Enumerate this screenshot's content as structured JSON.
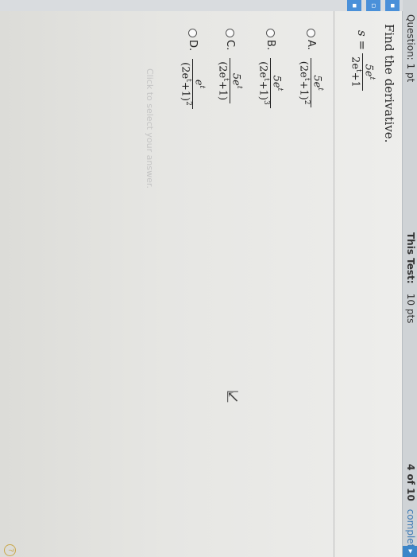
{
  "header": {
    "question_points": "Question: 1 pt",
    "test_points_label": "This Test:",
    "test_points_value": "10 pts",
    "progress_count": "4 of 10",
    "progress_word": "complete"
  },
  "question": {
    "prompt": "Find the derivative.",
    "function": {
      "lhs": "s =",
      "numerator": "5e",
      "num_exp": "t",
      "denominator": "2e",
      "den_exp": "t",
      "den_tail": "+1"
    }
  },
  "options": [
    {
      "label": "A.",
      "numerator": "5e",
      "num_exp": "t",
      "denominator": "(2e",
      "den_exp": "t",
      "den_tail": "+1)",
      "den_power": "2"
    },
    {
      "label": "B.",
      "numerator": "5e",
      "num_exp": "t",
      "denominator": "(2e",
      "den_exp": "t",
      "den_tail": "+1)",
      "den_power": "3"
    },
    {
      "label": "C.",
      "numerator": "5e",
      "num_exp": "t",
      "denominator": "(2e",
      "den_exp": "t",
      "den_tail": "+1)",
      "den_power": ""
    },
    {
      "label": "D.",
      "numerator": "e",
      "num_exp": "t",
      "denominator": "(2e",
      "den_exp": "t",
      "den_tail": "+1)",
      "den_power": "2"
    }
  ],
  "hint": "Click to select your answer.",
  "icons": {
    "cursor": "arrow-cursor-icon",
    "help": "help-icon"
  }
}
